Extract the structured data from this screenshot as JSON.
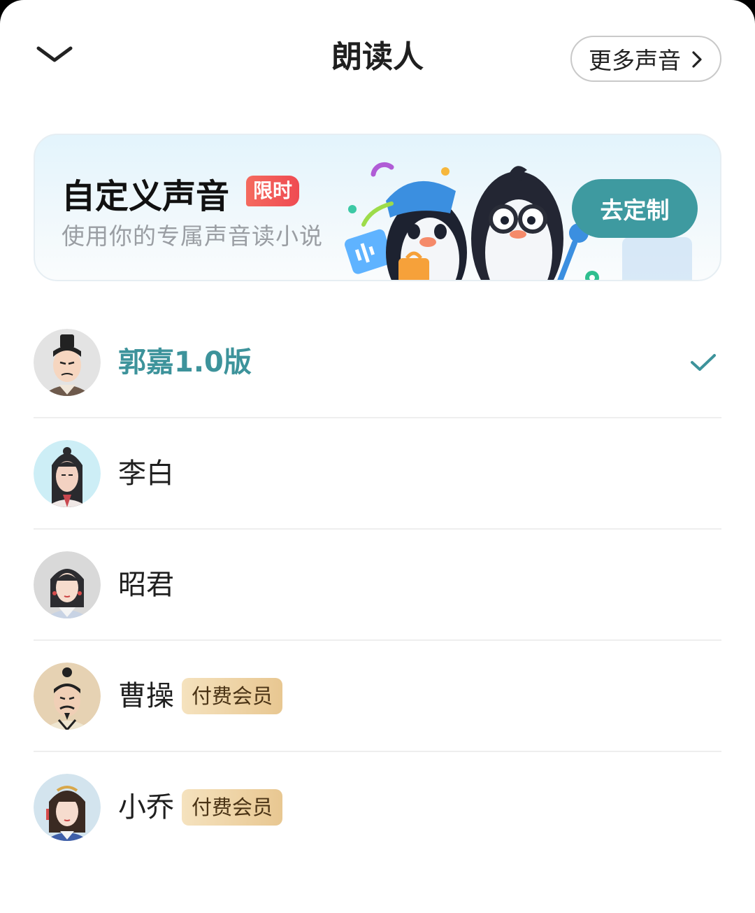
{
  "header": {
    "title": "朗读人",
    "more_label": "更多声音"
  },
  "banner": {
    "title": "自定义声音",
    "badge": "限时",
    "subtitle": "使用你的专属声音读小说",
    "button_label": "去定制"
  },
  "voices": [
    {
      "name": "郭嘉1.0版",
      "selected": true
    },
    {
      "name": "李白"
    },
    {
      "name": "昭君"
    },
    {
      "name": "曹操",
      "badge": "付费会员"
    },
    {
      "name": "小乔",
      "badge": "付费会员"
    }
  ],
  "colors": {
    "accent": "#3e9aa0",
    "selected_text": "#3d939b",
    "limit_badge": "#ef4b52",
    "member_badge": "#e8c791"
  },
  "icons": {
    "collapse": "chevron-down-icon",
    "more": "chevron-right-icon",
    "selected": "checkmark-icon"
  }
}
